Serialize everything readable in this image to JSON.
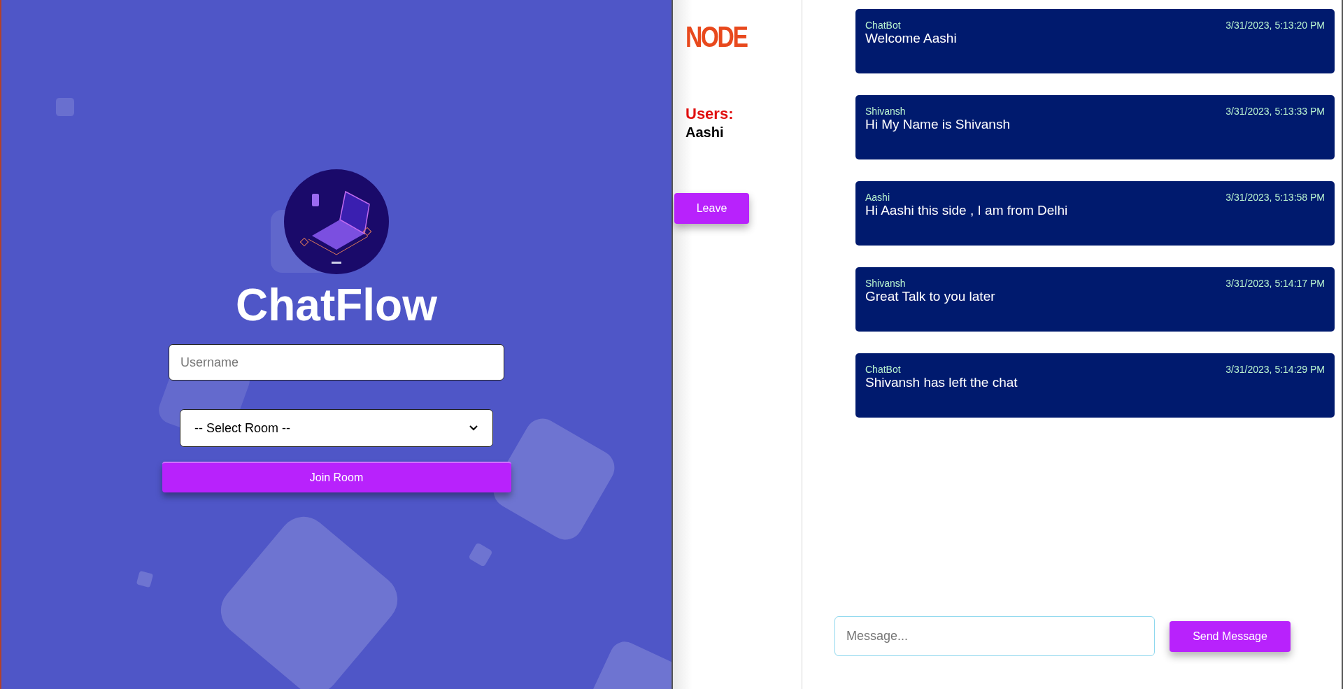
{
  "join_panel": {
    "title": "ChatFlow",
    "username": {
      "placeholder": "Username"
    },
    "room_select": {
      "value": "-- Select Room --"
    },
    "join_button": "Join Room"
  },
  "sidebar": {
    "logo": "NODE",
    "users_heading": "Users:",
    "users": [
      "Aashi"
    ],
    "leave_button": "Leave"
  },
  "messages": [
    {
      "sender": "ChatBot",
      "time": "3/31/2023, 5:13:20 PM",
      "text": "Welcome Aashi"
    },
    {
      "sender": "Shivansh",
      "time": "3/31/2023, 5:13:33 PM",
      "text": "Hi My Name is Shivansh"
    },
    {
      "sender": "Aashi",
      "time": "3/31/2023, 5:13:58 PM",
      "text": "Hi Aashi this side , I am from Delhi"
    },
    {
      "sender": "Shivansh",
      "time": "3/31/2023, 5:14:17 PM",
      "text": "Great Talk to you later"
    },
    {
      "sender": "ChatBot",
      "time": "3/31/2023, 5:14:29 PM",
      "text": "Shivansh has left the chat"
    }
  ],
  "composer": {
    "placeholder": "Message...",
    "send_button": "Send Message"
  }
}
